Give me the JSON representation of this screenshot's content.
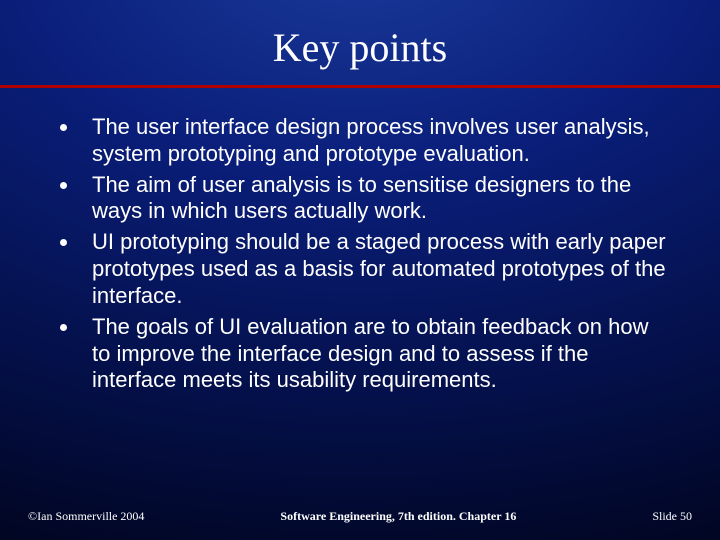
{
  "title": "Key points",
  "bullets": [
    "The user interface design process involves user analysis, system prototyping and prototype evaluation.",
    "The aim of user analysis is to sensitise designers to the ways in which users actually work.",
    "UI prototyping should be a staged process with early paper prototypes used as a basis for automated prototypes of the interface.",
    "The goals of UI evaluation are to obtain feedback on how to improve the interface design and to assess if the interface meets its usability requirements."
  ],
  "footer": {
    "left": "©Ian Sommerville 2004",
    "center": "Software Engineering, 7th edition. Chapter 16",
    "right": "Slide 50"
  }
}
